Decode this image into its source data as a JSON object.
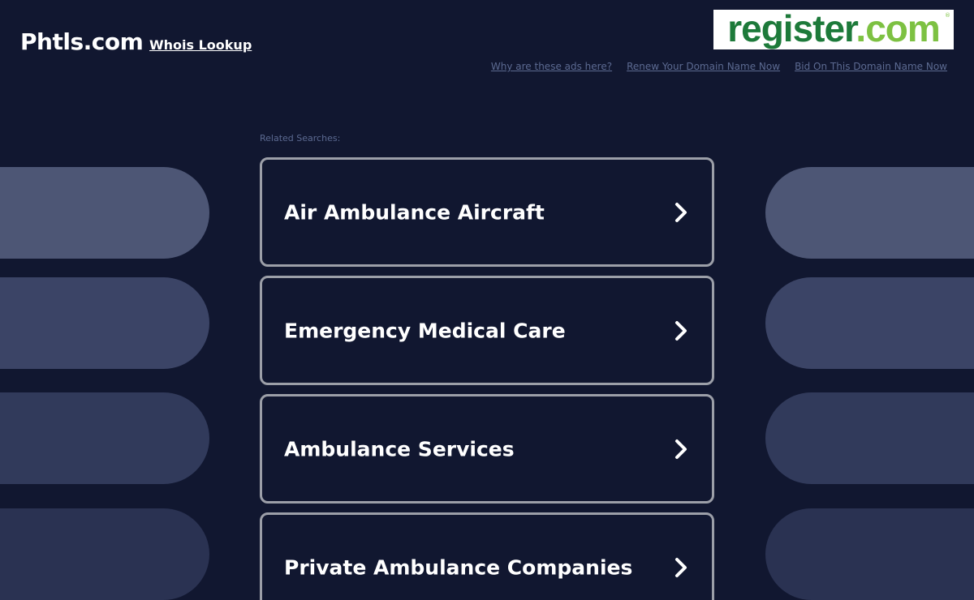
{
  "header": {
    "domain": "Phtls.com",
    "whois_label": "Whois Lookup"
  },
  "logo": {
    "name": "register",
    "tld": ".com",
    "mark": "®"
  },
  "top_links": [
    "Why are these ads here?",
    "Renew Your Domain Name Now",
    "Bid On This Domain Name Now"
  ],
  "related": {
    "label": "Related Searches:",
    "items": [
      "Air Ambulance Aircraft",
      "Emergency Medical Care",
      "Ambulance Services",
      "Private Ambulance Companies"
    ]
  },
  "colors": {
    "background": "#111730",
    "logo_green_dark": "#1d7a3a",
    "logo_green_light": "#7dc142",
    "link_muted": "#5c6a91",
    "box_border": "#9c9fa8"
  }
}
